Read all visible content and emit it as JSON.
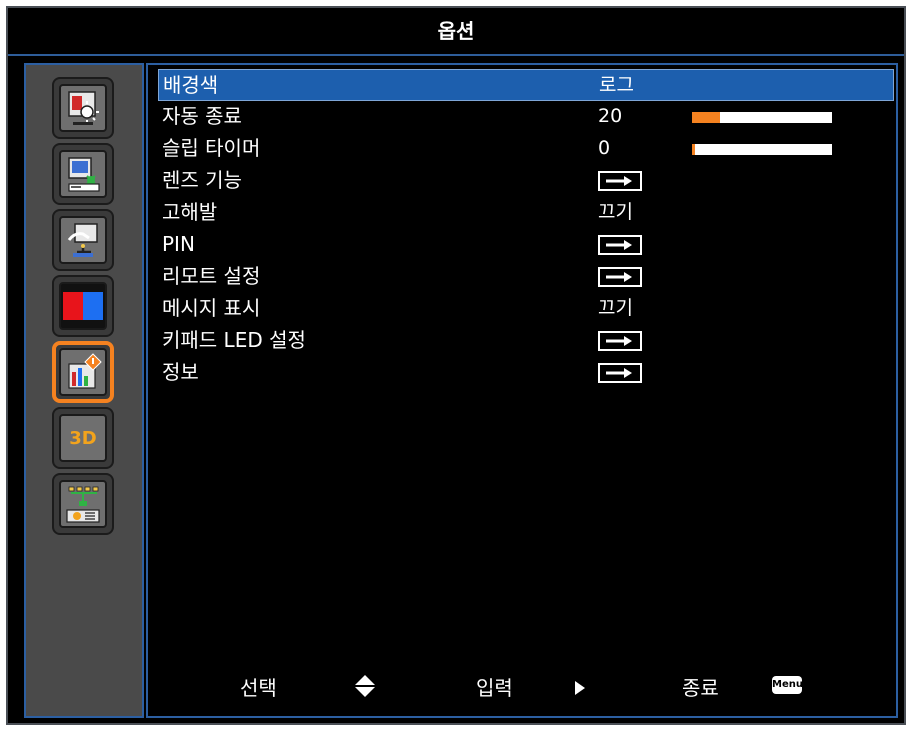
{
  "title": "옵션",
  "sidebar": {
    "tabs": [
      {
        "icon": "image-settings-icon"
      },
      {
        "icon": "display-settings-icon"
      },
      {
        "icon": "setup-settings-icon"
      },
      {
        "icon": "color-settings-icon"
      },
      {
        "icon": "options-icon"
      },
      {
        "icon": "3d-icon",
        "text": "3D"
      },
      {
        "icon": "network-icon"
      }
    ],
    "active_index": 4
  },
  "menu": {
    "items": [
      {
        "label": "배경색",
        "value": "로그",
        "selected": true
      },
      {
        "label": "자동 종료",
        "value": "20",
        "bar_fraction": 0.2
      },
      {
        "label": "슬립 타이머",
        "value": "0",
        "bar_fraction": 0.0
      },
      {
        "label": "렌즈 기능",
        "value_icon": "enter-arrow-icon"
      },
      {
        "label": "고해발",
        "value": "끄기"
      },
      {
        "label": "PIN",
        "value_icon": "enter-arrow-icon"
      },
      {
        "label": "리모트 설정",
        "value_icon": "enter-arrow-icon"
      },
      {
        "label": "메시지 표시",
        "value": "끄기"
      },
      {
        "label": "키패드 LED 설정",
        "value_icon": "enter-arrow-icon"
      },
      {
        "label": "정보",
        "value_icon": "enter-arrow-icon"
      }
    ]
  },
  "footer": {
    "select_label": "선택",
    "enter_label": "입력",
    "exit_label": "종료",
    "menu_key": "Menu"
  },
  "colors": {
    "highlight": "#1d5fae",
    "accent": "#f58220",
    "border": "#2c5fa2"
  }
}
